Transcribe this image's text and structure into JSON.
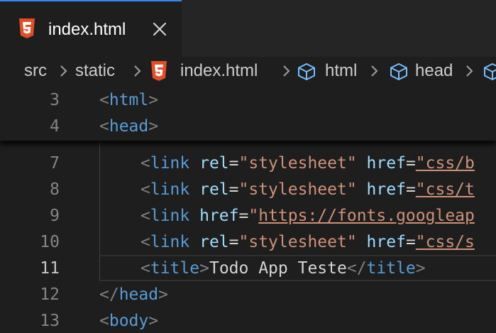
{
  "tab": {
    "label": "index.html",
    "icon": "html5-icon",
    "close_icon": "close-icon",
    "accent_color": "#3b82f6"
  },
  "breadcrumb": {
    "items": [
      {
        "label": "src",
        "icon": ""
      },
      {
        "label": "static",
        "icon": ""
      },
      {
        "label": "index.html",
        "icon": "html5-icon"
      },
      {
        "label": "html",
        "icon": "cube-icon"
      },
      {
        "label": "head",
        "icon": "cube-icon"
      }
    ]
  },
  "sticky_lines": [
    {
      "number": "3",
      "open": "<",
      "tag": "html",
      "close": ">"
    },
    {
      "number": "4",
      "open": "<",
      "tag": "head",
      "close": ">"
    }
  ],
  "lines": [
    {
      "number": "7",
      "open": "<",
      "tag": "link",
      "a1": "rel",
      "v1": "\"stylesheet\"",
      "a2": "href",
      "v2": "\"css/b"
    },
    {
      "number": "8",
      "open": "<",
      "tag": "link",
      "a1": "rel",
      "v1": "\"stylesheet\"",
      "a2": "href",
      "v2": "\"css/t"
    },
    {
      "number": "9",
      "open": "<",
      "tag": "link",
      "a1": "href",
      "v1": "\"",
      "url": "https://fonts.googleap"
    },
    {
      "number": "10",
      "open": "<",
      "tag": "link",
      "a1": "rel",
      "v1": "\"stylesheet\"",
      "a2": "href",
      "v2": "\"css/s"
    },
    {
      "number": "11",
      "open": "<",
      "tag": "title",
      "close": ">",
      "text": "Todo App Teste",
      "end_open": "</",
      "end_tag": "title",
      "end_close": ">"
    },
    {
      "number": "12",
      "open": "</",
      "tag": "head",
      "close": ">"
    },
    {
      "number": "13",
      "open": "<",
      "tag": "body",
      "close": ">"
    }
  ],
  "colors": {
    "background": "#1e1e1e",
    "tag": "#569cd6",
    "attribute": "#9cdcfe",
    "string": "#ce9178",
    "bracket": "#808080",
    "line_number": "#858585",
    "html5_orange": "#e44d26"
  }
}
